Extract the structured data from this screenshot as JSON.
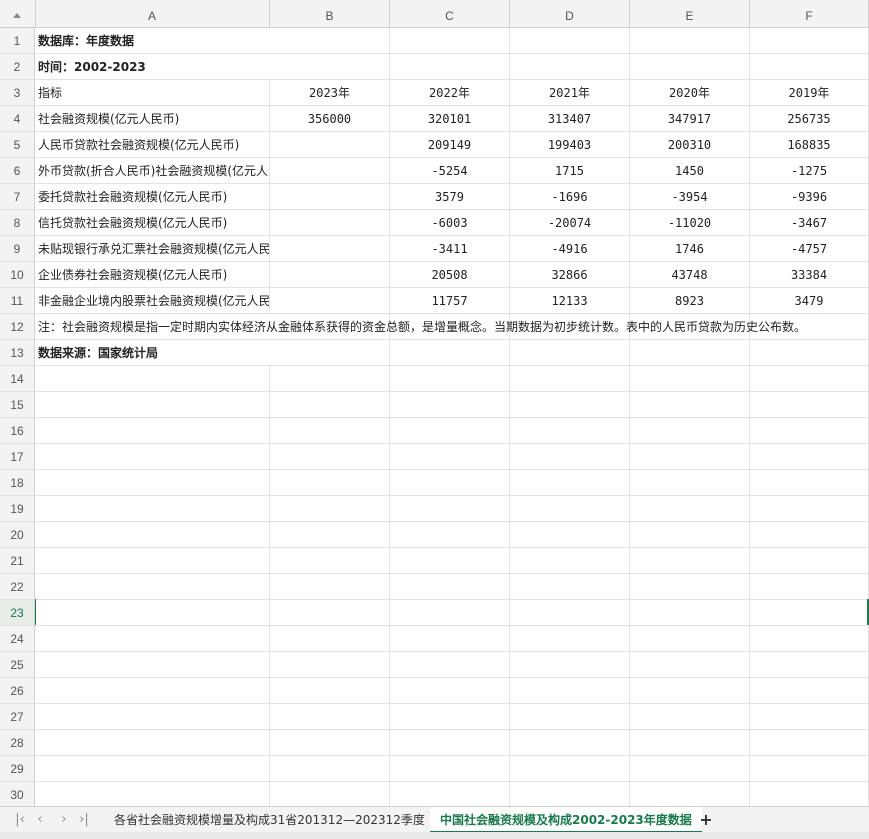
{
  "columns": [
    "A",
    "B",
    "C",
    "D",
    "E",
    "F"
  ],
  "row_numbers": [
    "1",
    "2",
    "3",
    "4",
    "5",
    "6",
    "7",
    "8",
    "9",
    "10",
    "11",
    "12",
    "13",
    "14",
    "15",
    "16",
    "17",
    "18",
    "19",
    "20",
    "21",
    "22",
    "23",
    "24",
    "25",
    "26",
    "27",
    "28",
    "29",
    "30"
  ],
  "active_row": "23",
  "rows": [
    {
      "a": "数据库：年度数据",
      "bold": true,
      "spill": true,
      "b": "",
      "c": "",
      "d": "",
      "e": "",
      "f": ""
    },
    {
      "a": "时间：2002-2023",
      "bold": true,
      "spill": true,
      "b": "",
      "c": "",
      "d": "",
      "e": "",
      "f": ""
    },
    {
      "a": "指标",
      "b": "2023年",
      "c": "2022年",
      "d": "2021年",
      "e": "2020年",
      "f": "2019年"
    },
    {
      "a": "社会融资规模(亿元人民币)",
      "b": "356000",
      "c": "320101",
      "d": "313407",
      "e": "347917",
      "f": "256735"
    },
    {
      "a": "人民币贷款社会融资规模(亿元人民币)",
      "b": "",
      "c": "209149",
      "d": "199403",
      "e": "200310",
      "f": "168835"
    },
    {
      "a": "外币贷款(折合人民币)社会融资规模(亿元人民币)",
      "b": "",
      "c": "-5254",
      "d": "1715",
      "e": "1450",
      "f": "-1275"
    },
    {
      "a": "委托贷款社会融资规模(亿元人民币)",
      "b": "",
      "c": "3579",
      "d": "-1696",
      "e": "-3954",
      "f": "-9396"
    },
    {
      "a": "信托贷款社会融资规模(亿元人民币)",
      "b": "",
      "c": "-6003",
      "d": "-20074",
      "e": "-11020",
      "f": "-3467"
    },
    {
      "a": "未贴现银行承兑汇票社会融资规模(亿元人民币)",
      "b": "",
      "c": "-3411",
      "d": "-4916",
      "e": "1746",
      "f": "-4757"
    },
    {
      "a": "企业债券社会融资规模(亿元人民币)",
      "b": "",
      "c": "20508",
      "d": "32866",
      "e": "43748",
      "f": "33384"
    },
    {
      "a": "非金融企业境内股票社会融资规模(亿元人民币)",
      "b": "",
      "c": "11757",
      "d": "12133",
      "e": "8923",
      "f": "3479"
    },
    {
      "a": "注：社会融资规模是指一定时期内实体经济从金融体系获得的资金总额，是增量概念。当期数据为初步统计数。表中的人民币贷款为历史公布数。",
      "spill": true,
      "b": "",
      "c": "",
      "d": "",
      "e": "",
      "f": ""
    },
    {
      "a": "数据来源：国家统计局",
      "bold": true,
      "spill": true,
      "b": "",
      "c": "",
      "d": "",
      "e": "",
      "f": ""
    }
  ],
  "sheet_tabs": [
    {
      "label": "各省社会融资规模增量及构成31省201312—202312季度",
      "selected": false
    },
    {
      "label": "中国社会融资规模及构成2002-2023年度数据",
      "selected": true
    }
  ],
  "nav_icons": [
    "first-sheet-icon",
    "prev-sheet-icon",
    "next-sheet-icon",
    "last-sheet-icon"
  ],
  "add_sheet_label": "+",
  "accent_color": "#1a7a4c"
}
